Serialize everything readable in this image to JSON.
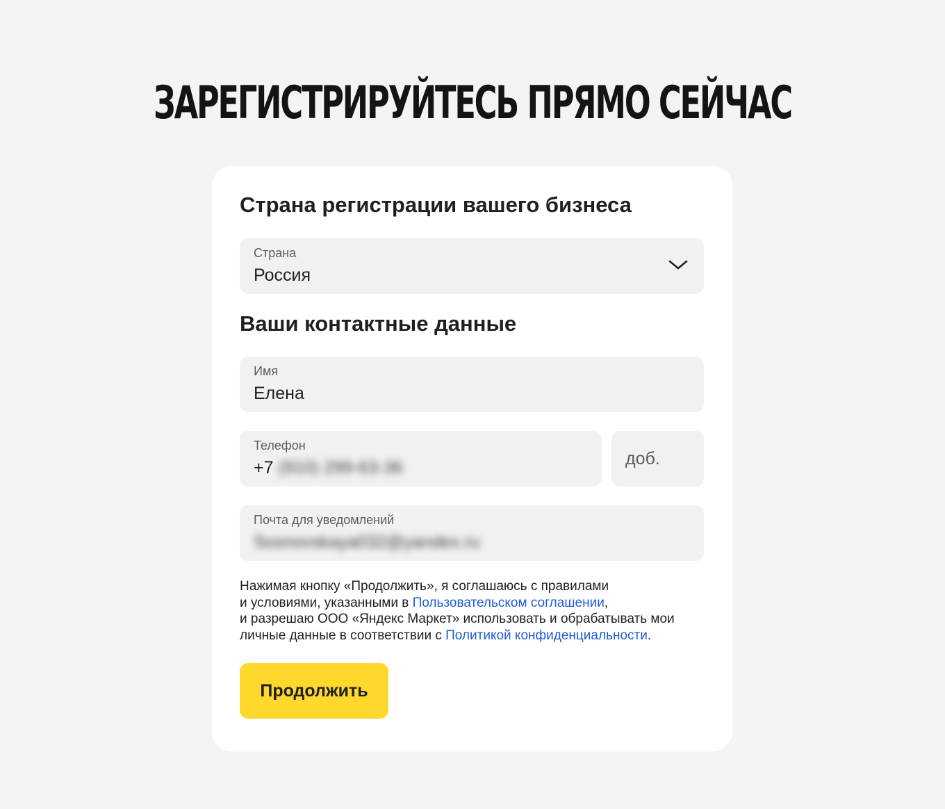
{
  "hero": {
    "title": "ЗАРЕГИСТРИРУЙТЕСЬ ПРЯМО СЕЙЧАС"
  },
  "country_section": {
    "title": "Страна регистрации вашего бизнеса",
    "field": {
      "label": "Страна",
      "value": "Россия",
      "icon": "chevron-down-icon"
    }
  },
  "contact_section": {
    "title": "Ваши контактные данные",
    "name_field": {
      "label": "Имя",
      "value": "Елена"
    },
    "phone_field": {
      "label": "Телефон",
      "prefix": "+7",
      "value": "(910) 299-63-36"
    },
    "extension_field": {
      "placeholder": "доб."
    },
    "email_field": {
      "label": "Почта для уведомлений",
      "value": "Sosnovskaya032@yandex.ru"
    }
  },
  "legal": {
    "line1": "Нажимая кнопку «Продолжить», я соглашаюсь с правилами",
    "line2_before": "и условиями, указанными в ",
    "line2_link": "Пользовательском соглашении",
    "line2_after": ",",
    "line3": "и разрешаю ООО «Яндекс Маркет» использовать и обрабатывать мои",
    "line4_before": "личные данные в соответствии с ",
    "line4_link": "Политикой конфиденциальности",
    "line4_after": ".",
    "link_color": "#1f5cd6"
  },
  "continue_button": {
    "label": "Продолжить",
    "color": "#ffd82e"
  }
}
